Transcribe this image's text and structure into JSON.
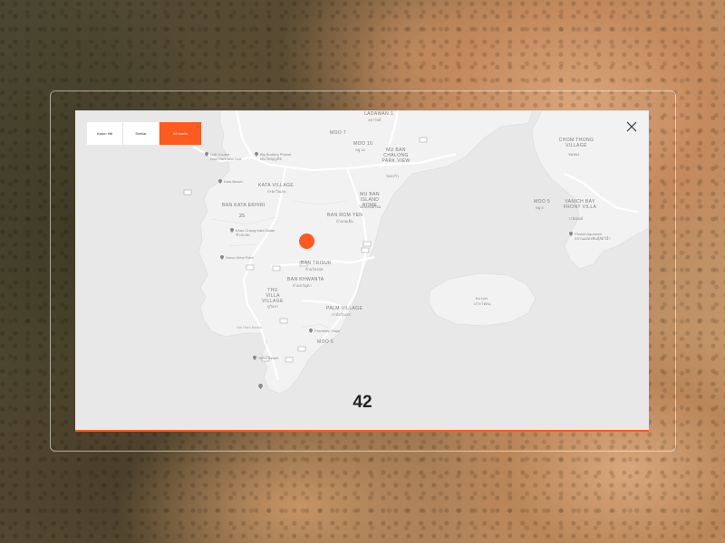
{
  "tabs": [
    {
      "label": "Karon Hill",
      "active": false
    },
    {
      "label": "Similar",
      "active": false
    },
    {
      "label": "All hotels",
      "active": true
    }
  ],
  "counter": "42",
  "accent_color": "#ff5a1f",
  "map_labels": {
    "ladawan": "LADAWAN 1",
    "ladawan_th": "ลดาวัลย์",
    "moo7_top": "MOO 7",
    "moo10": "MOO 10",
    "moo10_th": "หมู่ 10",
    "mu_ban_chalong": "MU BAN CHALONG PARK VIEW",
    "chalong_th": "ชลองวิว",
    "big_buddha": "Big Buddha Phuket",
    "big_buddha_th": "พระใหญ่ภูเก็ต",
    "golf": "Golf Course",
    "golf_sub": "Dino Park Mini Golf",
    "kata_village": "KATA VILLAGE",
    "kata_village_th": "กะตะวิลเลจ",
    "karon_beach": "Kata Beach",
    "mu_ban_island": "MU BAN ISLAND HOME",
    "island_th": "ไอส์แลนด์โฮม",
    "ban_kata_ekhiri": "BAN KATA EKHIRI",
    "road_25": "25",
    "ban_rom_yen": "BAN ROM YEN",
    "rom_yen_th": "บ้านร่มเย็น",
    "khao_chang": "Khao Chang Kata Safari",
    "khao_chang_th": "ช้างกะตะ",
    "karon_viewpoint": "Karon View Point",
    "ban_trisuk": "BAN TRISUK",
    "trisuk_th": "บ้านไตรสุข",
    "ban_khwanta": "BAN KHWANTA",
    "khwanta_th": "บ้านขวัญตา",
    "thu_villa": "THU VILLA VILLAGE",
    "thu_villa_th": "ทูวิลล่า",
    "palm_village": "PALM VILLAGE",
    "palm_th": "ปาล์มวิลเลจ",
    "nai_harn": "Nai Harn Beach",
    "promthep": "Promthep Cape",
    "moo6": "MOO 6",
    "yanui": "Yanui Beach",
    "chom_thong": "CHOM THONG VILLAGE",
    "chom_thong_th": "ชมทอง",
    "moo5": "MOO 5",
    "moo5_th": "หมู่ 5",
    "vanich_bay": "VANICH BAY FRONT VILLA",
    "vanich_th": "วานิชเบย์",
    "phuket_aquarium": "Phuket Aquarium",
    "aquarium_th": "สถานแสดงพันธุ์สัตว์น้ำ",
    "ko_lon": "Ko Lon",
    "ko_lon_th": "เกาะโหลน"
  }
}
